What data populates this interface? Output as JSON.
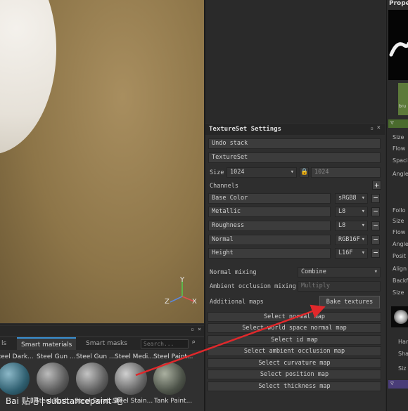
{
  "viewport": {
    "axes": {
      "y": "Y",
      "z": "Z",
      "x": "X"
    }
  },
  "shelf": {
    "tabs": [
      {
        "label": "ls",
        "active": false
      },
      {
        "label": "Smart materials",
        "active": true
      },
      {
        "label": "Smart masks",
        "active": false
      }
    ],
    "search_placeholder": "Search...",
    "items_top": [
      "Steel Dark...",
      "Steel Gun ...",
      "Steel Gun ...",
      "Steel Medi...",
      "Steel Paint..."
    ],
    "items_bottom": [
      "Steel Rust...",
      "Steel Scrat...",
      "Steel Stain...",
      "Tank Paint..."
    ]
  },
  "texture_set_settings": {
    "title": "TextureSet Settings",
    "undo_stack": "Undo stack",
    "texture_set_name": "TextureSet",
    "size_label": "Size",
    "size_value": "1024",
    "size_value_linked": "1024",
    "channels_label": "Channels",
    "channels": [
      {
        "name": "Base Color",
        "format": "sRGB8"
      },
      {
        "name": "Metallic",
        "format": "L8"
      },
      {
        "name": "Roughness",
        "format": "L8"
      },
      {
        "name": "Normal",
        "format": "RGB16F"
      },
      {
        "name": "Height",
        "format": "L16F"
      }
    ],
    "normal_mixing_label": "Normal mixing",
    "normal_mixing_value": "Combine",
    "ao_mixing_label": "Ambient occlusion mixing",
    "ao_mixing_value": "Multiply",
    "additional_maps_label": "Additional maps",
    "bake_textures": "Bake textures",
    "select_maps": [
      "Select normal map",
      "Select world space normal map",
      "Select id map",
      "Select ambient occlusion map",
      "Select curvature map",
      "Select position map",
      "Select thickness map"
    ]
  },
  "properties": {
    "title": "Prope",
    "brush_label": "bru",
    "items": [
      "Size",
      "Flow",
      "Spaci",
      "Angle",
      "Follo",
      "Size",
      "Flow",
      "Angle",
      "Posit",
      "Align",
      "Backf",
      "Size",
      "Har",
      "Sha",
      "Siz"
    ]
  },
  "watermark": {
    "text": "Bai 贴吧 | substancepaint 吧"
  },
  "colors": {
    "accent_blue": "#3a8fd0",
    "arrow_red": "#e0282b",
    "properties_header_green": "#4a6b2d"
  }
}
